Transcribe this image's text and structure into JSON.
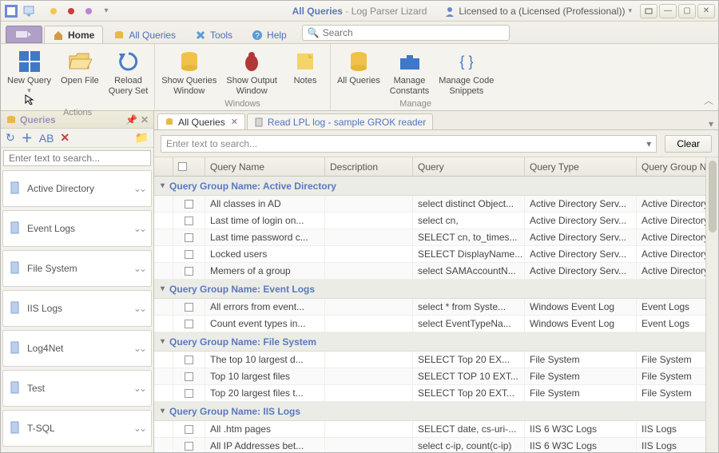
{
  "app": {
    "title_prefix": "All Queries",
    "title_suffix": "Log Parser Lizard",
    "license_label": "Licensed to a (Licensed (Professional))"
  },
  "ribbon": {
    "tabs": {
      "home": "Home",
      "all_queries": "All Queries",
      "tools": "Tools",
      "help": "Help"
    },
    "search_placeholder": "Search",
    "groups": {
      "actions": {
        "label": "Actions",
        "new_query": "New Query",
        "open_file": "Open File",
        "reload_query_set": "Reload\nQuery Set"
      },
      "windows": {
        "label": "Windows",
        "show_queries_window": "Show Queries\nWindow",
        "show_output_window": "Show Output\nWindow",
        "notes": "Notes"
      },
      "manage": {
        "label": "Manage",
        "all_queries": "All Queries",
        "manage_constants": "Manage\nConstants",
        "manage_snippets": "Manage Code\nSnippets"
      }
    }
  },
  "side": {
    "title": "Queries",
    "search_placeholder": "Enter text to search...",
    "categories": [
      "Active Directory",
      "Event Logs",
      "File System",
      "IIS Logs",
      "Log4Net",
      "Test",
      "T-SQL"
    ]
  },
  "doc_tabs": {
    "all_queries": "All Queries",
    "read_lpl": "Read LPL log - sample GROK reader"
  },
  "grid": {
    "search_placeholder": "Enter text to search...",
    "clear": "Clear",
    "columns": {
      "query_name": "Query Name",
      "description": "Description",
      "query": "Query",
      "query_type": "Query Type",
      "query_group_name": "Query Group Name"
    },
    "group_label_prefix": "Query Group Name: ",
    "groups": [
      {
        "name": "Active Directory",
        "rows": [
          {
            "name": "All classes in AD",
            "desc": "",
            "query": "select distinct Object...",
            "type": "Active Directory Serv...",
            "group": "Active Directory"
          },
          {
            "name": "Last time of login on...",
            "desc": "",
            "query": "select cn,",
            "type": "Active Directory Serv...",
            "group": "Active Directory"
          },
          {
            "name": "Last time password c...",
            "desc": "",
            "query": "SELECT cn, to_times...",
            "type": "Active Directory Serv...",
            "group": "Active Directory"
          },
          {
            "name": "Locked users",
            "desc": "",
            "query": "SELECT DisplayName...",
            "type": "Active Directory Serv...",
            "group": "Active Directory"
          },
          {
            "name": "Memers of a group",
            "desc": "",
            "query": "select SAMAccountN...",
            "type": "Active Directory Serv...",
            "group": "Active Directory"
          }
        ]
      },
      {
        "name": "Event Logs",
        "rows": [
          {
            "name": "All errors from event...",
            "desc": "",
            "query": "select * from Syste...",
            "type": "Windows Event Log",
            "group": "Event Logs"
          },
          {
            "name": "Count event types in...",
            "desc": "",
            "query": "select EventTypeNa...",
            "type": "Windows Event Log",
            "group": "Event Logs"
          }
        ]
      },
      {
        "name": "File System",
        "rows": [
          {
            "name": "The top 10 largest d...",
            "desc": "",
            "query": "SELECT Top 20   EX...",
            "type": "File System",
            "group": "File System"
          },
          {
            "name": "Top 10 largest files",
            "desc": "",
            "query": "SELECT TOP 10 EXT...",
            "type": "File System",
            "group": "File System"
          },
          {
            "name": "Top 20 largest files t...",
            "desc": "",
            "query": "SELECT Top 20  EXT...",
            "type": "File System",
            "group": "File System"
          }
        ]
      },
      {
        "name": "IIS Logs",
        "rows": [
          {
            "name": "All .htm pages",
            "desc": "",
            "query": "SELECT date, cs-uri-...",
            "type": "IIS 6 W3C Logs",
            "group": "IIS Logs"
          },
          {
            "name": "All IP Addresses bet...",
            "desc": "",
            "query": "select c-ip, count(c-ip)",
            "type": "IIS 6 W3C Logs",
            "group": "IIS Logs"
          }
        ]
      }
    ]
  }
}
